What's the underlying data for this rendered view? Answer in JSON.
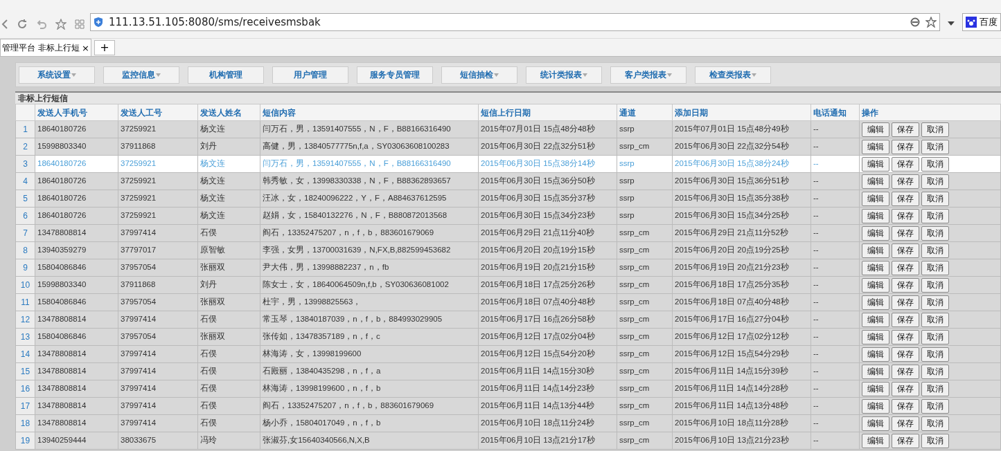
{
  "browser": {
    "url": "111.13.51.105:8080/sms/receivesmsbak",
    "tab": {
      "title": "管理平台 非标上行短",
      "close": "×"
    },
    "new_tab": "+",
    "search_engine": "百度"
  },
  "menu": [
    {
      "label": "系统设置",
      "dropdown": true
    },
    {
      "label": "监控信息",
      "dropdown": true
    },
    {
      "label": "机构管理",
      "dropdown": false
    },
    {
      "label": "用户管理",
      "dropdown": false
    },
    {
      "label": "服务专员管理",
      "dropdown": false
    },
    {
      "label": "短信抽检",
      "dropdown": true
    },
    {
      "label": "统计类报表",
      "dropdown": true
    },
    {
      "label": "客户类报表",
      "dropdown": true
    },
    {
      "label": "检查类报表",
      "dropdown": true
    }
  ],
  "table": {
    "title": "非标上行短信",
    "columns": [
      "发送人手机号",
      "发送人工号",
      "发送人姓名",
      "短信内容",
      "短信上行日期",
      "通道",
      "添加日期",
      "电话通知",
      "操作"
    ],
    "rows": [
      {
        "index": "1",
        "selected": false,
        "phone": "18640180726",
        "staff_id": "37259921",
        "name": "杨文连",
        "content": "闫万石，男，13591407555，N，F，B88166316490",
        "up_date": "2015年07月01日  15点48分48秒",
        "channel": "ssrp",
        "added": "2015年07月01日  15点48分49秒",
        "notify": "--",
        "actions": [
          "编辑",
          "保存",
          "取消"
        ]
      },
      {
        "index": "2",
        "selected": false,
        "phone": "15998803340",
        "staff_id": "37911868",
        "name": "刘丹",
        "content": "高健，男，13840577775n,f,a，SY03063608100283",
        "up_date": "2015年06月30日  22点32分51秒",
        "channel": "ssrp_cm",
        "added": "2015年06月30日  22点32分54秒",
        "notify": "--",
        "actions": [
          "编辑",
          "保存",
          "取消"
        ]
      },
      {
        "index": "3",
        "selected": true,
        "phone": "18640180726",
        "staff_id": "37259921",
        "name": "杨文连",
        "content": "闫万石，男，13591407555，N，F，B88166316490",
        "up_date": "2015年06月30日  15点38分14秒",
        "channel": "ssrp",
        "added": "2015年06月30日  15点38分24秒",
        "notify": "--",
        "actions": [
          "编辑",
          "保存",
          "取消"
        ]
      },
      {
        "index": "4",
        "selected": false,
        "phone": "18640180726",
        "staff_id": "37259921",
        "name": "杨文连",
        "content": "韩秀敏，女，13998330338，N，F，B88362893657",
        "up_date": "2015年06月30日  15点36分50秒",
        "channel": "ssrp",
        "added": "2015年06月30日  15点36分51秒",
        "notify": "--",
        "actions": [
          "编辑",
          "保存",
          "取消"
        ]
      },
      {
        "index": "5",
        "selected": false,
        "phone": "18640180726",
        "staff_id": "37259921",
        "name": "杨文连",
        "content": "汪冰，女，18240096222，Y，F，A884637612595",
        "up_date": "2015年06月30日  15点35分37秒",
        "channel": "ssrp",
        "added": "2015年06月30日  15点35分38秒",
        "notify": "--",
        "actions": [
          "编辑",
          "保存",
          "取消"
        ]
      },
      {
        "index": "6",
        "selected": false,
        "phone": "18640180726",
        "staff_id": "37259921",
        "name": "杨文连",
        "content": "赵娟，女，15840132276，N，F，B880872013568",
        "up_date": "2015年06月30日  15点34分23秒",
        "channel": "ssrp",
        "added": "2015年06月30日  15点34分25秒",
        "notify": "--",
        "actions": [
          "编辑",
          "保存",
          "取消"
        ]
      },
      {
        "index": "7",
        "selected": false,
        "phone": "13478808814",
        "staff_id": "37997414",
        "name": "石俣",
        "content": "阎石，13352475207，n，f，b，883601679069",
        "up_date": "2015年06月29日  21点11分40秒",
        "channel": "ssrp_cm",
        "added": "2015年06月29日  21点11分52秒",
        "notify": "--",
        "actions": [
          "编辑",
          "保存",
          "取消"
        ]
      },
      {
        "index": "8",
        "selected": false,
        "phone": "13940359279",
        "staff_id": "37797017",
        "name": "原智敏",
        "content": "李强，女男，13700031639，N,FX,B,882599453682",
        "up_date": "2015年06月20日  20点19分15秒",
        "channel": "ssrp_cm",
        "added": "2015年06月20日  20点19分25秒",
        "notify": "--",
        "actions": [
          "编辑",
          "保存",
          "取消"
        ]
      },
      {
        "index": "9",
        "selected": false,
        "phone": "15804086846",
        "staff_id": "37957054",
        "name": "张丽双",
        "content": "尹大伟，男，13998882237，n，fb",
        "up_date": "2015年06月19日  20点21分15秒",
        "channel": "ssrp_cm",
        "added": "2015年06月19日  20点21分23秒",
        "notify": "--",
        "actions": [
          "编辑",
          "保存",
          "取消"
        ]
      },
      {
        "index": "10",
        "selected": false,
        "phone": "15998803340",
        "staff_id": "37911868",
        "name": "刘丹",
        "content": "陈女士，女，18640064509n,f,b，SY030636081002",
        "up_date": "2015年06月18日  17点25分26秒",
        "channel": "ssrp_cm",
        "added": "2015年06月18日  17点25分35秒",
        "notify": "--",
        "actions": [
          "编辑",
          "保存",
          "取消"
        ]
      },
      {
        "index": "11",
        "selected": false,
        "phone": "15804086846",
        "staff_id": "37957054",
        "name": "张丽双",
        "content": "杜宇，男，13998825563，",
        "up_date": "2015年06月18日  07点40分48秒",
        "channel": "ssrp_cm",
        "added": "2015年06月18日  07点40分48秒",
        "notify": "--",
        "actions": [
          "编辑",
          "保存",
          "取消"
        ]
      },
      {
        "index": "12",
        "selected": false,
        "phone": "13478808814",
        "staff_id": "37997414",
        "name": "石俣",
        "content": "常玉琴，13840187039，n，f，b，884993029905",
        "up_date": "2015年06月17日  16点26分58秒",
        "channel": "ssrp_cm",
        "added": "2015年06月17日  16点27分04秒",
        "notify": "--",
        "actions": [
          "编辑",
          "保存",
          "取消"
        ]
      },
      {
        "index": "13",
        "selected": false,
        "phone": "15804086846",
        "staff_id": "37957054",
        "name": "张丽双",
        "content": "张传如，13478357189，n，f，c",
        "up_date": "2015年06月12日  17点02分04秒",
        "channel": "ssrp_cm",
        "added": "2015年06月12日  17点02分12秒",
        "notify": "--",
        "actions": [
          "编辑",
          "保存",
          "取消"
        ]
      },
      {
        "index": "14",
        "selected": false,
        "phone": "13478808814",
        "staff_id": "37997414",
        "name": "石俣",
        "content": "林海涛，女，13998199600",
        "up_date": "2015年06月12日  15点54分20秒",
        "channel": "ssrp_cm",
        "added": "2015年06月12日  15点54分29秒",
        "notify": "--",
        "actions": [
          "编辑",
          "保存",
          "取消"
        ]
      },
      {
        "index": "15",
        "selected": false,
        "phone": "13478808814",
        "staff_id": "37997414",
        "name": "石俣",
        "content": "石殿丽，13840435298，n，f，a",
        "up_date": "2015年06月11日  14点15分30秒",
        "channel": "ssrp_cm",
        "added": "2015年06月11日  14点15分39秒",
        "notify": "--",
        "actions": [
          "编辑",
          "保存",
          "取消"
        ]
      },
      {
        "index": "16",
        "selected": false,
        "phone": "13478808814",
        "staff_id": "37997414",
        "name": "石俣",
        "content": "林海涛，13998199600，n，f，b",
        "up_date": "2015年06月11日  14点14分23秒",
        "channel": "ssrp_cm",
        "added": "2015年06月11日  14点14分28秒",
        "notify": "--",
        "actions": [
          "编辑",
          "保存",
          "取消"
        ]
      },
      {
        "index": "17",
        "selected": false,
        "phone": "13478808814",
        "staff_id": "37997414",
        "name": "石俣",
        "content": "阎石，13352475207，n，f，b，883601679069",
        "up_date": "2015年06月11日  14点13分44秒",
        "channel": "ssrp_cm",
        "added": "2015年06月11日  14点13分48秒",
        "notify": "--",
        "actions": [
          "编辑",
          "保存",
          "取消"
        ]
      },
      {
        "index": "18",
        "selected": false,
        "phone": "13478808814",
        "staff_id": "37997414",
        "name": "石俣",
        "content": "杨小乔，15804017049，n，f，b",
        "up_date": "2015年06月10日  18点11分24秒",
        "channel": "ssrp_cm",
        "added": "2015年06月10日  18点11分28秒",
        "notify": "--",
        "actions": [
          "编辑",
          "保存",
          "取消"
        ]
      },
      {
        "index": "19",
        "selected": false,
        "phone": "13940259444",
        "staff_id": "38033675",
        "name": "冯玲",
        "content": "张淑芬,女15640340566,N,X,B",
        "up_date": "2015年06月10日  13点21分17秒",
        "channel": "ssrp_cm",
        "added": "2015年06月10日  13点21分23秒",
        "notify": "--",
        "actions": [
          "编辑",
          "保存",
          "取消"
        ]
      }
    ]
  }
}
